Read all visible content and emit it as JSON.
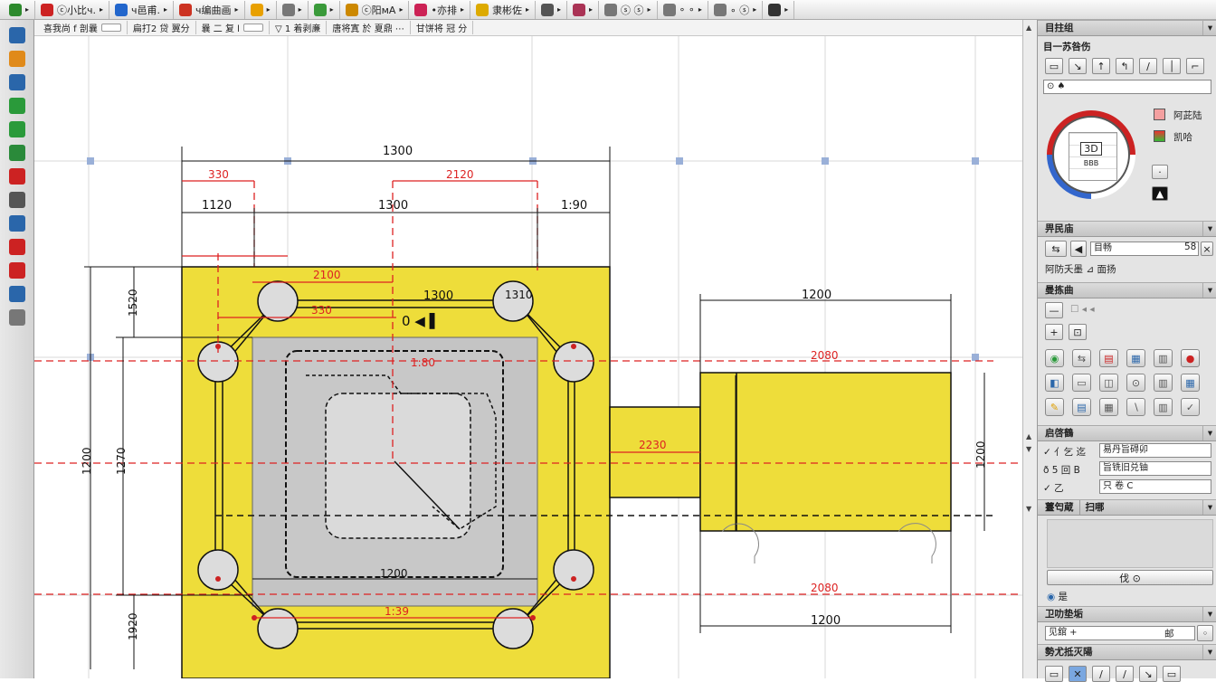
{
  "toolbar": {
    "groups": [
      {
        "icon": "app-icon",
        "label": "",
        "color": "#2d8a2d"
      },
      {
        "icon": "file-icon",
        "label": "ⓒ小比ч.",
        "color": "#cc2222"
      },
      {
        "icon": "window-icon",
        "label": "ч邑甫.",
        "color": "#2266cc"
      },
      {
        "icon": "text-icon",
        "label": "ч编曲画",
        "color": "#cc3322"
      },
      {
        "icon": "color-icon",
        "label": "",
        "color": "#e8a000"
      },
      {
        "icon": "line-icon",
        "label": "",
        "color": "#777777"
      },
      {
        "icon": "globe-icon",
        "label": "",
        "color": "#3a9a3a"
      },
      {
        "icon": "pencil-icon",
        "label": "ⓒ阳мA",
        "color": "#cc8800"
      },
      {
        "icon": "snap-icon",
        "label": "•亦排",
        "color": "#cc2255"
      },
      {
        "icon": "edit-icon",
        "label": "隶彬佐",
        "color": "#ddaa00"
      },
      {
        "icon": "view-icon",
        "label": "",
        "color": "#555555"
      },
      {
        "icon": "layer-icon",
        "label": "",
        "color": "#aa3355"
      },
      {
        "icon": "grid-icon",
        "label": "ⓢ  ⓢ",
        "color": "#777777"
      },
      {
        "icon": "zoom-icon",
        "label": "∘ ∘",
        "color": "#777777"
      },
      {
        "icon": "measure-icon",
        "label": "∘ ⓢ",
        "color": "#777777"
      },
      {
        "icon": "nav-icon",
        "label": "",
        "color": "#333333"
      }
    ],
    "row2": [
      "喜我尚 f 剖曩",
      "扁打2 贷 翼分",
      "曩 二 复 l",
      "▽ 1 着剥亷",
      "唐将寘 於 夏鼎 ⋯",
      "甘饼将 冠 分"
    ]
  },
  "left_tools": [
    {
      "icon": "cube-icon",
      "color": "#2a66aa"
    },
    {
      "icon": "chart-icon",
      "color": "#e08a1a"
    },
    {
      "icon": "pen-icon",
      "color": "#2a66aa"
    },
    {
      "icon": "curve-icon",
      "color": "#2a9a3a"
    },
    {
      "icon": "t-icon",
      "color": "#2a9a3a"
    },
    {
      "icon": "image-icon",
      "color": "#2a8a3a"
    },
    {
      "icon": "shape-icon",
      "color": "#cc2222"
    },
    {
      "icon": "flag-icon",
      "color": "#555555"
    },
    {
      "icon": "measure-icon",
      "color": "#2a66aa"
    },
    {
      "icon": "cut-icon",
      "color": "#cc2222"
    },
    {
      "icon": "x-icon",
      "color": "#cc2222"
    },
    {
      "icon": "globe-icon",
      "color": "#2a66aa"
    },
    {
      "icon": "doc-icon",
      "color": "#777777"
    }
  ],
  "drawing": {
    "dims_black": [
      "1300",
      "1120",
      "1300",
      "1:90",
      "1300",
      "1200",
      "1200",
      "1200",
      "1310",
      "1200",
      "1270",
      "1520",
      "1920",
      "1200"
    ],
    "dims_red": [
      "330",
      "2120",
      "2100",
      "330",
      "1:80",
      "2080",
      "2080",
      "2230",
      "1:39"
    ],
    "hole_label": "1300",
    "corner_label": "1:80",
    "small_labels": [
      "0 ◀ ▌"
    ],
    "colors": {
      "plate": "#eedd3a",
      "inner": "#c4c4c4",
      "inner2": "#d8d8d8",
      "dim": "#111111",
      "red": "#dd2222",
      "grid_marker": "#9ab0d8"
    }
  },
  "panel": {
    "sec1": {
      "title": "目拄组",
      "subtitle": "目一苏咎伤",
      "dropdown": "⊙ ♠",
      "legend": [
        {
          "label": "阿茈陆",
          "color": "#ff9999"
        },
        {
          "label": "凯哈",
          "color": "#44bb33"
        }
      ],
      "dial_label": "3D",
      "dial_sub": "BBB"
    },
    "sec2": {
      "title": "畀民庙",
      "field": "目畅",
      "field_val": "58",
      "row": "阿防夭墨 ⊿ 面扬"
    },
    "sec3": {
      "title": "曼拣曲"
    },
    "sec4": {
      "title": "启啓鶴",
      "rows": [
        {
          "label": "✓ 亻乞 迄",
          "value": "易丹旨碍卯"
        },
        {
          "label": "ð 5 回 B",
          "value": "旨铣旧兑铀"
        },
        {
          "label": "✓ 乙",
          "value": "只 卷 C"
        }
      ]
    },
    "sec5": {
      "title": "薹匄蔵",
      "tab": "扫哪",
      "button": "伐 ⊙",
      "row": "是"
    },
    "sec6": {
      "title": "卫叻垫垢",
      "field": "见舘 +",
      "field_val": "邮"
    },
    "sec7": {
      "title": "勢尤抵灭陽"
    }
  }
}
